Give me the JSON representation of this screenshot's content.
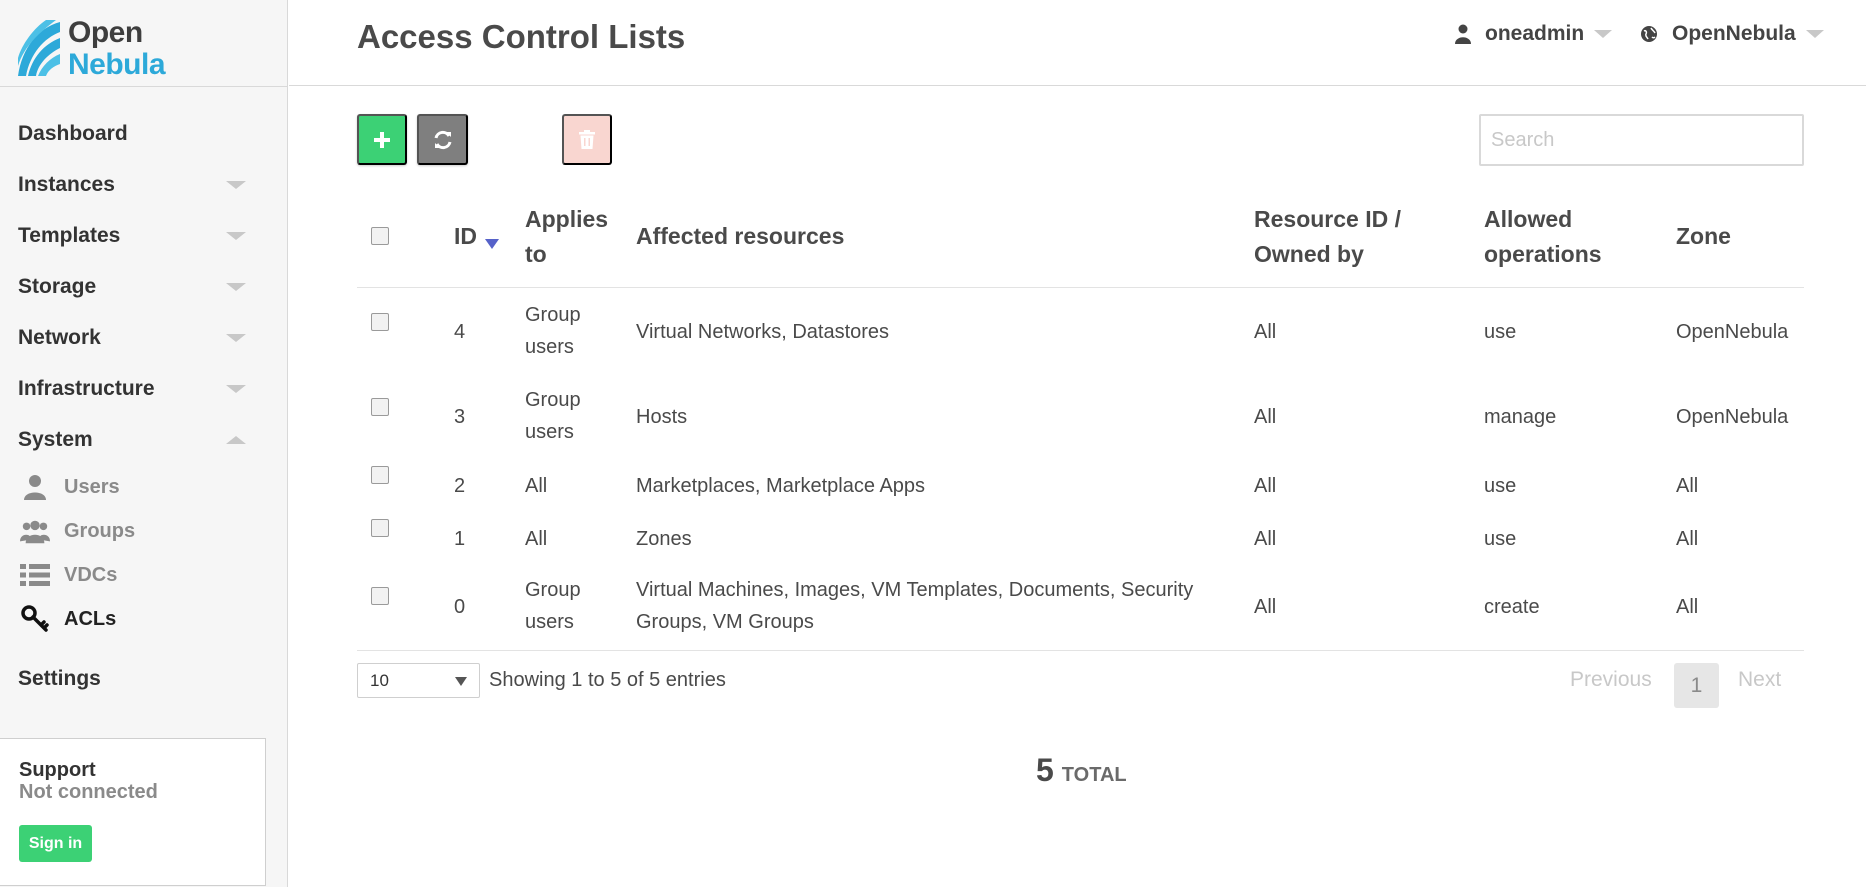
{
  "logo": {
    "line1": "Open",
    "line2": "Nebula"
  },
  "sidebar": {
    "items": [
      {
        "label": "Dashboard"
      },
      {
        "label": "Instances"
      },
      {
        "label": "Templates"
      },
      {
        "label": "Storage"
      },
      {
        "label": "Network"
      },
      {
        "label": "Infrastructure"
      },
      {
        "label": "System"
      }
    ],
    "system_sub": [
      {
        "label": "Users",
        "icon": "user-icon"
      },
      {
        "label": "Groups",
        "icon": "groups-icon"
      },
      {
        "label": "VDCs",
        "icon": "list-icon"
      },
      {
        "label": "ACLs",
        "icon": "key-icon"
      }
    ],
    "settings": "Settings"
  },
  "support": {
    "title": "Support",
    "status": "Not connected",
    "signin": "Sign in"
  },
  "header": {
    "title": "Access Control Lists",
    "user": "oneadmin",
    "zone": "OpenNebula"
  },
  "toolbar": {
    "search_placeholder": "Search"
  },
  "table": {
    "columns": [
      "ID",
      "Applies to",
      "Affected resources",
      "Resource ID / Owned by",
      "Allowed operations",
      "Zone"
    ],
    "rows": [
      {
        "id": "4",
        "applies": "Group users",
        "resources": "Virtual Networks, Datastores",
        "owned": "All",
        "ops": "use",
        "zone": "OpenNebula"
      },
      {
        "id": "3",
        "applies": "Group users",
        "resources": "Hosts",
        "owned": "All",
        "ops": "manage",
        "zone": "OpenNebula"
      },
      {
        "id": "2",
        "applies": "All",
        "resources": "Marketplaces, Marketplace Apps",
        "owned": "All",
        "ops": "use",
        "zone": "All"
      },
      {
        "id": "1",
        "applies": "All",
        "resources": "Zones",
        "owned": "All",
        "ops": "use",
        "zone": "All"
      },
      {
        "id": "0",
        "applies": "Group users",
        "resources": "Virtual Machines, Images, VM Templates, Documents, Security Groups, VM Groups",
        "owned": "All",
        "ops": "create",
        "zone": "All"
      }
    ]
  },
  "pagination": {
    "page_size": "10",
    "info": "Showing 1 to 5 of 5 entries",
    "previous": "Previous",
    "current": "1",
    "next": "Next"
  },
  "summary": {
    "total": "5",
    "total_label": "TOTAL"
  }
}
